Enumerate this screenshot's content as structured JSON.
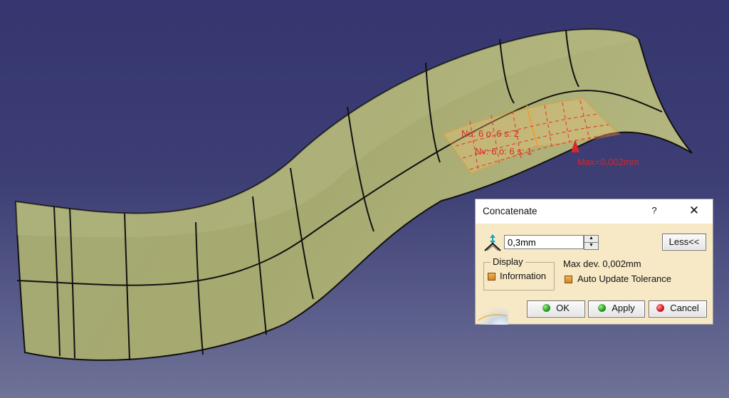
{
  "viewport": {
    "annotation_nu": "Nu: 6 o: 6 s: 2",
    "annotation_nv": "Nv: 6 o: 6 s: 1",
    "max_label": "Max=0,002mm"
  },
  "dialog": {
    "title": "Concatenate",
    "help_label": "?",
    "close_label": "✕",
    "tolerance_value": "0,3mm",
    "spin_up": "▲",
    "spin_down": "▼",
    "less_label": "Less<<",
    "display_group_label": "Display",
    "information_label": "Information",
    "information_checked": true,
    "max_dev_label": "Max dev. 0,002mm",
    "auto_update_label": "Auto Update Tolerance",
    "auto_update_checked": true,
    "ok_label": "OK",
    "apply_label": "Apply",
    "cancel_label": "Cancel"
  },
  "colors": {
    "background_top": "#363670",
    "surface": "#a6aa72",
    "highlight": "#f39a2a",
    "annotation": "#d8262a",
    "dialog_bg": "#f7e9c6"
  }
}
